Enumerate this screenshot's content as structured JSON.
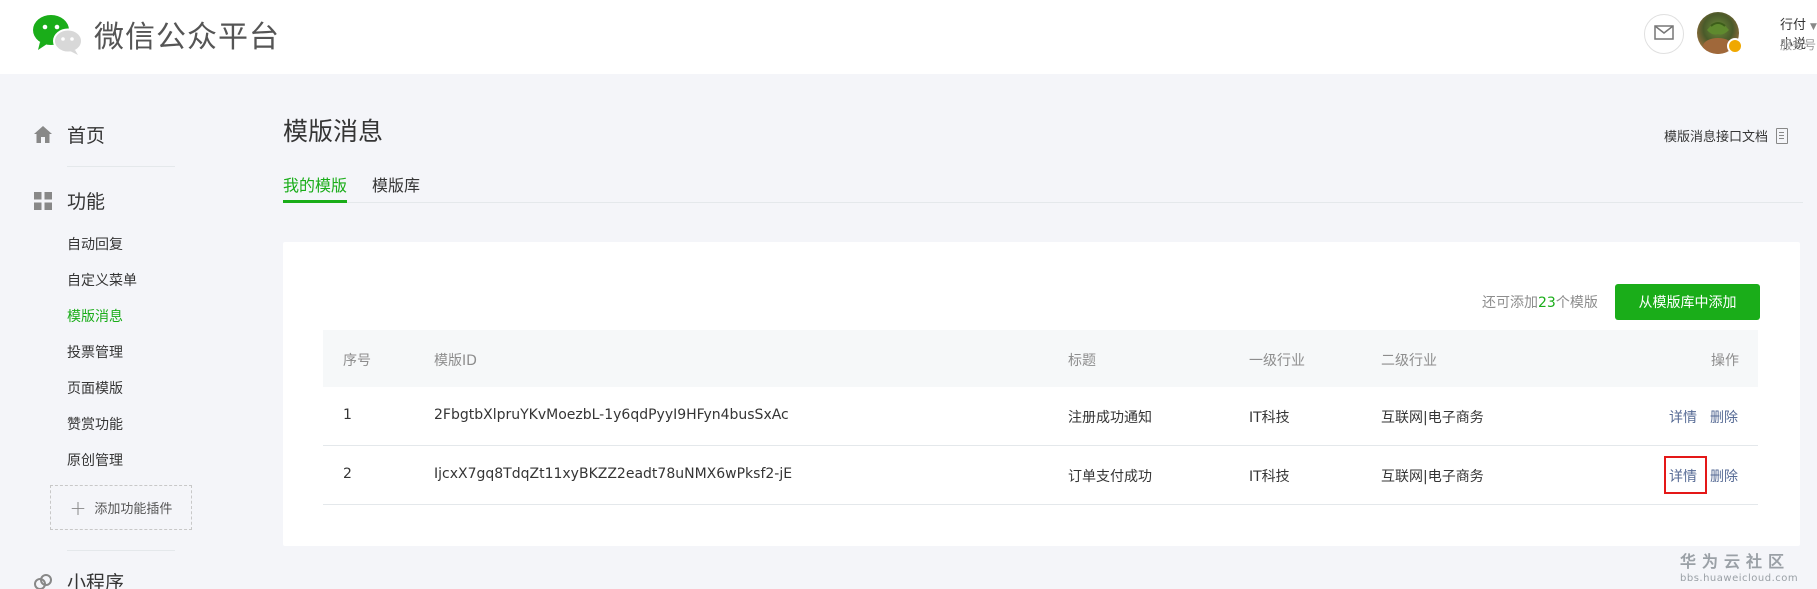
{
  "header": {
    "app_title": "微信公众平台",
    "user_name": "行付小说",
    "account_type": "服务号"
  },
  "sidebar": {
    "home": "首页",
    "features": "功能",
    "sub_items": [
      {
        "label": "自动回复"
      },
      {
        "label": "自定义菜单"
      },
      {
        "label": "模版消息",
        "active": true
      },
      {
        "label": "投票管理"
      },
      {
        "label": "页面模版"
      },
      {
        "label": "赞赏功能"
      },
      {
        "label": "原创管理"
      }
    ],
    "add_plugin": "添加功能插件",
    "mini_program": "小程序"
  },
  "main": {
    "title": "模版消息",
    "doc_link": "模版消息接口文档",
    "tabs": [
      {
        "label": "我的模版",
        "active": true
      },
      {
        "label": "模版库"
      }
    ],
    "quota_prefix": "还可添加",
    "quota_count": "23",
    "quota_suffix": "个模版",
    "add_button": "从模版库中添加",
    "table": {
      "headers": {
        "index": "序号",
        "template_id": "模版ID",
        "title": "标题",
        "industry1": "一级行业",
        "industry2": "二级行业",
        "actions": "操作"
      },
      "rows": [
        {
          "index": "1",
          "template_id": "2FbgtbXlpruYKvMoezbL-1y6qdPyyI9HFyn4busSxAc",
          "title": "注册成功通知",
          "industry1": "IT科技",
          "industry2": "互联网|电子商务",
          "detail": "详情",
          "delete": "删除"
        },
        {
          "index": "2",
          "template_id": "IjcxX7gq8TdqZt11xyBKZZ2eadt78uNMX6wPksf2-jE",
          "title": "订单支付成功",
          "industry1": "IT科技",
          "industry2": "互联网|电子商务",
          "detail": "详情",
          "delete": "删除"
        }
      ]
    }
  },
  "watermark": {
    "title": "华为云社区",
    "url": "bbs.huaweicloud.com"
  },
  "colors": {
    "brand_green": "#1aad19",
    "link_blue": "#576b95",
    "highlight_red": "#e41818"
  },
  "icons": {
    "logo": "wechat-logo-icon",
    "mail": "mail-icon",
    "home": "home-icon",
    "features": "grid-icon",
    "mini_program": "mini-program-icon",
    "doc": "document-icon"
  }
}
